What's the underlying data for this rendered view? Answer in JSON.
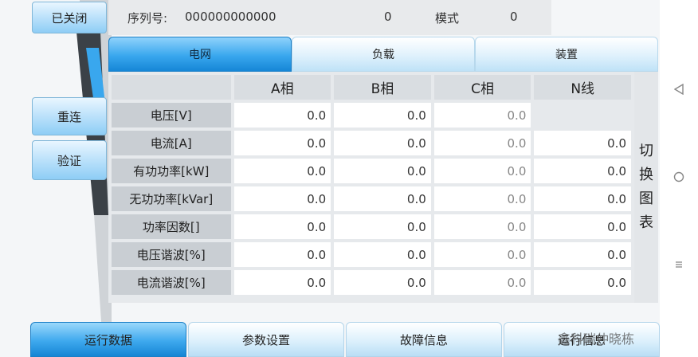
{
  "status": {
    "state_label": "已关闭"
  },
  "header": {
    "serial_label": "序列号:",
    "serial_value": "000000000000",
    "count_value": "0",
    "model_label": "模式",
    "model_value": "0"
  },
  "left_menu": {
    "btn1": "重连",
    "btn2": "验证"
  },
  "tabs": [
    {
      "label": "电网",
      "active": true
    },
    {
      "label": "负载",
      "active": false
    },
    {
      "label": "装置",
      "active": false
    }
  ],
  "table": {
    "columns": [
      "A相",
      "B相",
      "C相",
      "N线"
    ],
    "rows": [
      {
        "label": "电压[V]",
        "values": [
          "0.0",
          "0.0",
          "0.0",
          ""
        ]
      },
      {
        "label": "电流[A]",
        "values": [
          "0.0",
          "0.0",
          "0.0",
          "0.0"
        ]
      },
      {
        "label": "有功功率[kW]",
        "values": [
          "0.0",
          "0.0",
          "0.0",
          "0.0"
        ]
      },
      {
        "label": "无功功率[kVar]",
        "values": [
          "0.0",
          "0.0",
          "0.0",
          "0.0"
        ]
      },
      {
        "label": "功率因数[]",
        "values": [
          "0.0",
          "0.0",
          "0.0",
          "0.0"
        ]
      },
      {
        "label": "电压谐波[%]",
        "values": [
          "0.0",
          "0.0",
          "0.0",
          "0.0"
        ]
      },
      {
        "label": "电流谐波[%]",
        "values": [
          "0.0",
          "0.0",
          "0.0",
          "0.0"
        ]
      }
    ]
  },
  "switch_chart": [
    "切",
    "换",
    "图",
    "表"
  ],
  "bottom_tabs": [
    {
      "label": "运行数据",
      "active": true
    },
    {
      "label": "参数设置",
      "active": false
    },
    {
      "label": "故障信息",
      "active": false
    },
    {
      "label": "运行信息",
      "active": false
    }
  ],
  "watermark": "鑫科瑞仲晓栋",
  "nav_icons": [
    "back-triangle-icon",
    "home-circle-icon",
    "recent-menu-icon"
  ],
  "colors": {
    "accent": "#1586d6",
    "light_blue": "#bfe3fb",
    "panel_gray": "#e6e9ec"
  }
}
